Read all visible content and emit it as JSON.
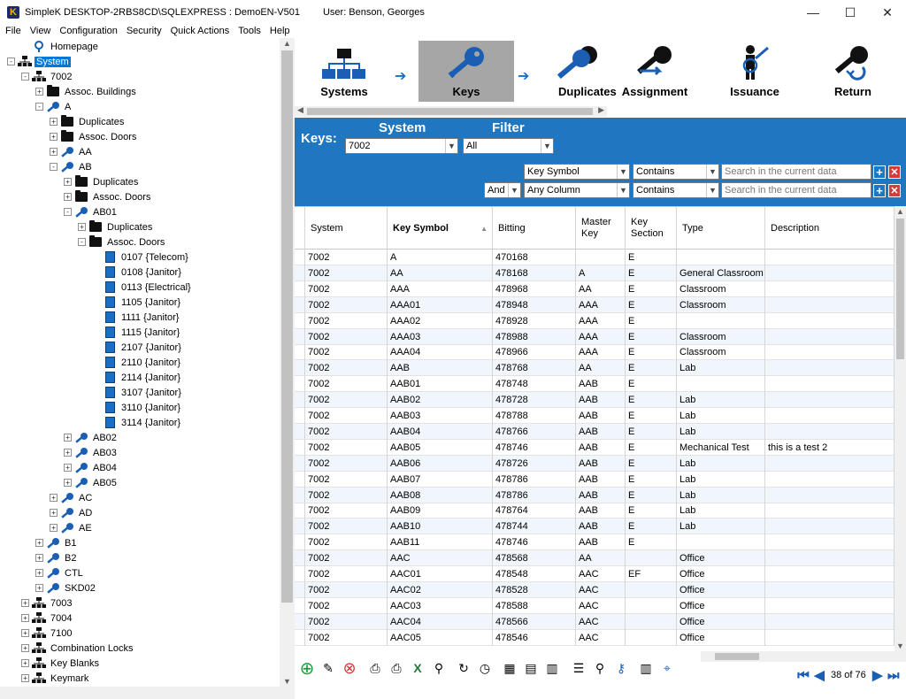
{
  "window": {
    "title": "SimpleK  DESKTOP-2RBS8CD\\SQLEXPRESS : DemoEN-V501",
    "user": "User: Benson, Georges",
    "minimize": "—",
    "maximize": "☐",
    "close": "✕"
  },
  "menu": [
    {
      "label": "File"
    },
    {
      "label": "View"
    },
    {
      "label": "Configuration"
    },
    {
      "label": "Security"
    },
    {
      "label": "Quick Actions"
    },
    {
      "label": "Tools"
    },
    {
      "label": "Help"
    }
  ],
  "tree": {
    "nodes": [
      {
        "label": "Homepage",
        "icon": "homepage-icon"
      },
      {
        "label": "System",
        "icon": "system-icon",
        "selected": true
      },
      {
        "label": "7002",
        "icon": "system-icon"
      },
      {
        "label": "Assoc. Buildings",
        "icon": "folder-icon"
      },
      {
        "label": "A",
        "icon": "key-icon"
      },
      {
        "label": "Duplicates",
        "icon": "folder-icon"
      },
      {
        "label": "Assoc. Doors",
        "icon": "folder-icon"
      },
      {
        "label": "AA",
        "icon": "key-icon"
      },
      {
        "label": "AB",
        "icon": "key-icon"
      },
      {
        "label": "Duplicates",
        "icon": "folder-icon"
      },
      {
        "label": "Assoc. Doors",
        "icon": "folder-icon"
      },
      {
        "label": "AB01",
        "icon": "key-icon"
      },
      {
        "label": "Duplicates",
        "icon": "folder-icon"
      },
      {
        "label": "Assoc. Doors",
        "icon": "folder-icon"
      },
      {
        "label": "0107 {Telecom}",
        "icon": "door-icon"
      },
      {
        "label": "0108 {Janitor}",
        "icon": "door-icon"
      },
      {
        "label": "0113 {Electrical}",
        "icon": "door-icon"
      },
      {
        "label": "1105 {Janitor}",
        "icon": "door-icon"
      },
      {
        "label": "1111 {Janitor}",
        "icon": "door-icon"
      },
      {
        "label": "1115 {Janitor}",
        "icon": "door-icon"
      },
      {
        "label": "2107 {Janitor}",
        "icon": "door-icon"
      },
      {
        "label": "2110 {Janitor}",
        "icon": "door-icon"
      },
      {
        "label": "2114 {Janitor}",
        "icon": "door-icon"
      },
      {
        "label": "3107 {Janitor}",
        "icon": "door-icon"
      },
      {
        "label": "3110 {Janitor}",
        "icon": "door-icon"
      },
      {
        "label": "3114 {Janitor}",
        "icon": "door-icon"
      },
      {
        "label": "AB02",
        "icon": "key-icon"
      },
      {
        "label": "AB03",
        "icon": "key-icon"
      },
      {
        "label": "AB04",
        "icon": "key-icon"
      },
      {
        "label": "AB05",
        "icon": "key-icon"
      },
      {
        "label": "AC",
        "icon": "key-icon"
      },
      {
        "label": "AD",
        "icon": "key-icon"
      },
      {
        "label": "AE",
        "icon": "key-icon"
      },
      {
        "label": "B1",
        "icon": "key-icon"
      },
      {
        "label": "B2",
        "icon": "key-icon"
      },
      {
        "label": "CTL",
        "icon": "key-icon"
      },
      {
        "label": "SKD02",
        "icon": "key-icon"
      },
      {
        "label": "7003",
        "icon": "system-icon"
      },
      {
        "label": "7004",
        "icon": "system-icon"
      },
      {
        "label": "7100",
        "icon": "system-icon"
      },
      {
        "label": "Combination Locks",
        "icon": "system-icon"
      },
      {
        "label": "Key Blanks",
        "icon": "system-icon"
      },
      {
        "label": "Keymark",
        "icon": "system-icon"
      }
    ]
  },
  "modules": [
    {
      "label": "Systems",
      "icon": "systems-icon",
      "active": false
    },
    {
      "label": "Keys",
      "icon": "keys-icon",
      "active": true
    },
    {
      "label": "Duplicates",
      "icon": "duplicates-icon",
      "active": false
    },
    {
      "label": "Assignment",
      "icon": "assignment-icon",
      "active": false
    },
    {
      "label": "Issuance",
      "icon": "issuance-icon",
      "active": false
    },
    {
      "label": "Return",
      "icon": "return-icon",
      "active": false
    }
  ],
  "filter": {
    "title": "Keys:",
    "system_header": "System",
    "filter_header": "Filter",
    "system_value": "7002",
    "filter_value": "All",
    "row1": {
      "column": "Key Symbol",
      "operator": "Contains",
      "placeholder": "Search in the current data"
    },
    "row2": {
      "conjunction": "And",
      "column": "Any Column",
      "operator": "Contains",
      "placeholder": "Search in the current data"
    }
  },
  "grid": {
    "columns": [
      "System",
      "Key Symbol",
      "Bitting",
      "Master Key",
      "Key Section",
      "Type",
      "Description"
    ],
    "rows": [
      [
        "7002",
        "A",
        "470168",
        "",
        "E",
        "",
        ""
      ],
      [
        "7002",
        "AA",
        "478168",
        "A",
        "E",
        "General Classroom",
        ""
      ],
      [
        "7002",
        "AAA",
        "478968",
        "AA",
        "E",
        "Classroom",
        ""
      ],
      [
        "7002",
        "AAA01",
        "478948",
        "AAA",
        "E",
        "Classroom",
        ""
      ],
      [
        "7002",
        "AAA02",
        "478928",
        "AAA",
        "E",
        "",
        ""
      ],
      [
        "7002",
        "AAA03",
        "478988",
        "AAA",
        "E",
        "Classroom",
        ""
      ],
      [
        "7002",
        "AAA04",
        "478966",
        "AAA",
        "E",
        "Classroom",
        ""
      ],
      [
        "7002",
        "AAB",
        "478768",
        "AA",
        "E",
        "Lab",
        ""
      ],
      [
        "7002",
        "AAB01",
        "478748",
        "AAB",
        "E",
        "",
        ""
      ],
      [
        "7002",
        "AAB02",
        "478728",
        "AAB",
        "E",
        "Lab",
        ""
      ],
      [
        "7002",
        "AAB03",
        "478788",
        "AAB",
        "E",
        "Lab",
        ""
      ],
      [
        "7002",
        "AAB04",
        "478766",
        "AAB",
        "E",
        "Lab",
        ""
      ],
      [
        "7002",
        "AAB05",
        "478746",
        "AAB",
        "E",
        "Mechanical Test",
        "this is a test 2"
      ],
      [
        "7002",
        "AAB06",
        "478726",
        "AAB",
        "E",
        "Lab",
        ""
      ],
      [
        "7002",
        "AAB07",
        "478786",
        "AAB",
        "E",
        "Lab",
        ""
      ],
      [
        "7002",
        "AAB08",
        "478786",
        "AAB",
        "E",
        "Lab",
        ""
      ],
      [
        "7002",
        "AAB09",
        "478764",
        "AAB",
        "E",
        "Lab",
        ""
      ],
      [
        "7002",
        "AAB10",
        "478744",
        "AAB",
        "E",
        "Lab",
        ""
      ],
      [
        "7002",
        "AAB11",
        "478746",
        "AAB",
        "E",
        "",
        ""
      ],
      [
        "7002",
        "AAC",
        "478568",
        "AA",
        "",
        "Office",
        ""
      ],
      [
        "7002",
        "AAC01",
        "478548",
        "AAC",
        "EF",
        "Office",
        ""
      ],
      [
        "7002",
        "AAC02",
        "478528",
        "AAC",
        "",
        "Office",
        ""
      ],
      [
        "7002",
        "AAC03",
        "478588",
        "AAC",
        "",
        "Office",
        ""
      ],
      [
        "7002",
        "AAC04",
        "478566",
        "AAC",
        "",
        "Office",
        ""
      ],
      [
        "7002",
        "AAC05",
        "478546",
        "AAC",
        "",
        "Office",
        ""
      ]
    ]
  },
  "pager": {
    "text": "38 of 76",
    "first": "⏮",
    "prev": "◀",
    "next": "▶",
    "last": "⏭"
  }
}
